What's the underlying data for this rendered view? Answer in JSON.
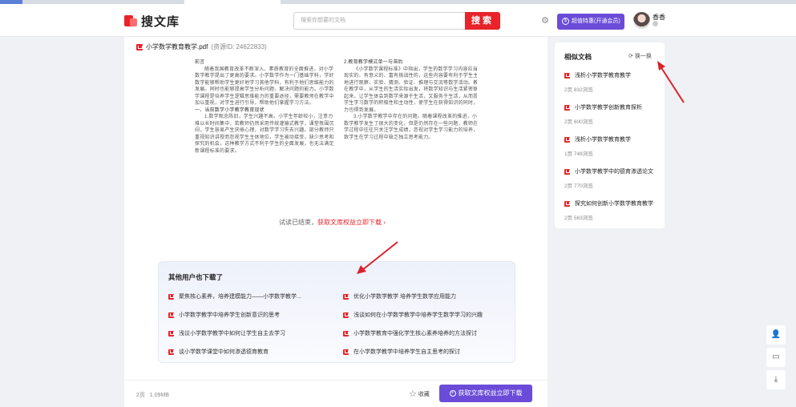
{
  "browser_tabs": [
    {
      "label": "",
      "x_hint": "first"
    },
    {
      "label": "",
      "x_hint": "second"
    },
    {
      "label": "",
      "x_hint": "third"
    },
    {
      "label": "",
      "x_hint": "active"
    }
  ],
  "header": {
    "logo_text": "搜文库",
    "search_placeholder": "搜索你想要的文档",
    "search_button": "搜索",
    "vip_label": "超值特惠(开通会员)",
    "username": "香香"
  },
  "document": {
    "title": "小学数学教育教学.pdf",
    "doc_id": "(资源ID: 24622833)",
    "left_column": [
      {
        "type": "h",
        "text": "前言"
      },
      {
        "type": "p",
        "text": "随着我国教育改革不断深入、素质教育的全面推进，对小学数学教学提出了更高的要求。小学数学作为一门基础学科，学好数学能够帮助学生更好地学习其他学科，有利于他们思维能力的发展。同时也能够提高学生分析问题、解决问题的能力。小学数学课程是培养学生逻辑思维能力的重要途径，需要教师在教学中加以重视，对学生进行引导，帮助他们掌握学习方法。"
      },
      {
        "type": "h",
        "text": "一、当前数学小学教学教育现状"
      },
      {
        "type": "p",
        "text": "1.数学观念陈旧，学生兴趣不高。小学生年龄较小，注意力难以长时间集中，若教师仍然采用传统灌输式教学，课堂氛围沉闷，学生容易产生厌倦心理，对数学学习失去兴趣。部分教师只重视知识讲授而忽视学生主体地位，学生被动接受，缺少思考和探究的机会，这种教学方式不利于学生的全面发展，也无法满足新课程标准的要求。"
      }
    ],
    "right_column": [
      {
        "type": "h",
        "text": "2.教育教学模式单一与滞后"
      },
      {
        "type": "p",
        "text": "《小学数学课程标准》中指出，学生的数学学习内容应当是现实的、有意义的、富有挑战性的，这些内容要有利于学生主动地进行观察、实验、猜测、验证、推理与交流等数学活动。教师在教学中，从学生的生活实际出发，将数学知识与生活紧密联系起来，让学生体会到数学来源于生活，又服务于生活，从而提高学生学习数学的积极性和主动性，使学生在获得知识的同时，能力也得到发展。"
      },
      {
        "type": "p",
        "text": "3.小学数学教学中存在的问题。随着课程改革的推进，小学数学教学发生了很大的变化，但是仍然存在一些问题，教师在教学过程中往往只关注学生成绩，忽视对学生学习能力的培养，导致学生在学习过程中缺乏独立思考能力。"
      }
    ],
    "trial_text": "试读已结束，",
    "trial_link": "获取文库权益立即下载 ›",
    "pages": "2页",
    "size": "1.09MB",
    "favorite_label": "收藏",
    "download_button": "获取文库权益立即下载"
  },
  "others_downloaded": {
    "title": "其他用户也下载了",
    "items": [
      "聚焦核心素养，培养建模能力——小学数学教学...",
      "优化小学数学教学 培养学生数学应用能力",
      "小学数学教学中培养学生创新意识的思考",
      "浅谈如何在小学数学教学中培养学生数学学习的兴趣",
      "浅议小学数学教学中如何让学生自主去学习",
      "小学数学教育中强化学生核心素养培养的方法探讨",
      "谈小学数学课堂中如何渗透德育教育",
      "在小学数学教学中培养学生自主思考的探讨"
    ]
  },
  "similar_docs": {
    "title": "相似文档",
    "refresh_label": "换一换",
    "items": [
      {
        "title": "浅析小学数学教育教学",
        "meta": "2页  832浏览"
      },
      {
        "title": "小学数学教学创新教育探析",
        "meta": "2页  600浏览"
      },
      {
        "title": "浅析小学数学教育教学",
        "meta": "1页  748浏览"
      },
      {
        "title": "小学数学教学中的德育渗透论文",
        "meta": "2页  770浏览"
      },
      {
        "title": "探究如何创新小学数学教育教学",
        "meta": "2页  563浏览"
      }
    ]
  },
  "colors": {
    "brand_red": "#e8232a",
    "purple": "#6b4cd8",
    "annotation_arrow": "#d9232c"
  }
}
